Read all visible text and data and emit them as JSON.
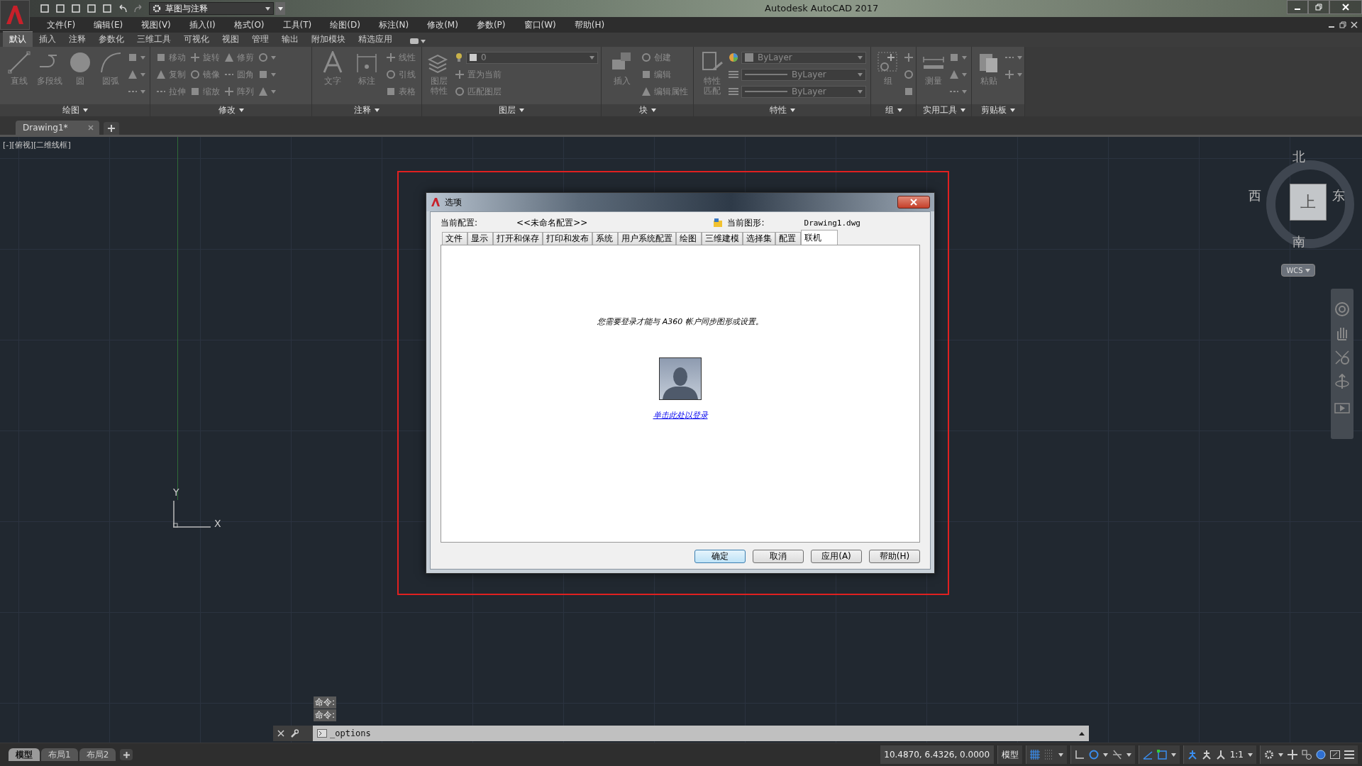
{
  "title_bar": {
    "workspace": "草图与注释",
    "title": "Autodesk AutoCAD 2017"
  },
  "menu": [
    "文件(F)",
    "编辑(E)",
    "视图(V)",
    "插入(I)",
    "格式(O)",
    "工具(T)",
    "绘图(D)",
    "标注(N)",
    "修改(M)",
    "参数(P)",
    "窗口(W)",
    "帮助(H)"
  ],
  "ribbon_tabs": [
    {
      "label": "默认",
      "selected": true
    },
    {
      "label": "插入",
      "selected": false
    },
    {
      "label": "注释",
      "selected": false
    },
    {
      "label": "参数化",
      "selected": false
    },
    {
      "label": "三维工具",
      "selected": false
    },
    {
      "label": "可视化",
      "selected": false
    },
    {
      "label": "视图",
      "selected": false
    },
    {
      "label": "管理",
      "selected": false
    },
    {
      "label": "输出",
      "selected": false
    },
    {
      "label": "附加模块",
      "selected": false
    },
    {
      "label": "精选应用",
      "selected": false
    }
  ],
  "ribbon_panels": [
    {
      "title": "绘图",
      "tools": [
        {
          "kind": "large",
          "label": "直线"
        },
        {
          "kind": "large",
          "label": "多段线"
        },
        {
          "kind": "large",
          "label": "圆"
        },
        {
          "kind": "large",
          "label": "圆弧"
        },
        {
          "kind": "stack",
          "rows": [
            {
              "kind": "icon"
            },
            {
              "kind": "icon"
            },
            {
              "kind": "icon"
            }
          ]
        }
      ]
    },
    {
      "title": "修改",
      "tools": [
        {
          "kind": "stack",
          "rows": [
            {
              "kind": "tool",
              "label": "移动"
            },
            {
              "kind": "tool",
              "label": "复制"
            },
            {
              "kind": "tool",
              "label": "拉伸"
            }
          ]
        },
        {
          "kind": "stack",
          "rows": [
            {
              "kind": "tool",
              "label": "旋转"
            },
            {
              "kind": "tool",
              "label": "镜像"
            },
            {
              "kind": "tool",
              "label": "缩放"
            }
          ]
        },
        {
          "kind": "stack",
          "rows": [
            {
              "kind": "tool",
              "label": "修剪"
            },
            {
              "kind": "tool",
              "label": "圆角"
            },
            {
              "kind": "tool",
              "label": "阵列"
            }
          ]
        },
        {
          "kind": "stack",
          "rows": [
            {
              "kind": "icon"
            },
            {
              "kind": "icon"
            },
            {
              "kind": "icon"
            }
          ]
        }
      ]
    },
    {
      "title": "注释",
      "tools": [
        {
          "kind": "large",
          "label": "文字"
        },
        {
          "kind": "large",
          "label": "标注"
        },
        {
          "kind": "stack",
          "rows": [
            {
              "kind": "tool",
              "label": "线性"
            },
            {
              "kind": "tool",
              "label": "引线"
            },
            {
              "kind": "tool",
              "label": "表格"
            }
          ]
        }
      ]
    },
    {
      "title": "图层",
      "tools": [
        {
          "kind": "large",
          "label": "图层特性"
        },
        {
          "kind": "stack",
          "rows": [
            {
              "kind": "dropdown",
              "value": "0"
            },
            {
              "kind": "tool",
              "label": "置为当前"
            },
            {
              "kind": "tool",
              "label": "匹配图层"
            }
          ]
        }
      ]
    },
    {
      "title": "块",
      "tools": [
        {
          "kind": "large",
          "label": "插入"
        },
        {
          "kind": "stack",
          "rows": [
            {
              "kind": "tool",
              "label": "创建"
            },
            {
              "kind": "tool",
              "label": "编辑"
            },
            {
              "kind": "tool",
              "label": "编辑属性"
            }
          ]
        }
      ]
    },
    {
      "title": "特性",
      "tools": [
        {
          "kind": "large",
          "label": "特性匹配"
        },
        {
          "kind": "stack",
          "rows": [
            {
              "kind": "swatch-dropdown",
              "value": "ByLayer"
            },
            {
              "kind": "line-dropdown",
              "value": "ByLayer"
            },
            {
              "kind": "line-dropdown",
              "value": "ByLayer"
            }
          ]
        }
      ]
    },
    {
      "title": "组",
      "tools": [
        {
          "kind": "large",
          "label": "组"
        },
        {
          "kind": "stack",
          "rows": [
            {
              "kind": "icon"
            },
            {
              "kind": "icon"
            },
            {
              "kind": "icon"
            }
          ]
        }
      ]
    },
    {
      "title": "实用工具",
      "tools": [
        {
          "kind": "large",
          "label": "测量"
        },
        {
          "kind": "stack",
          "rows": [
            {
              "kind": "icon"
            },
            {
              "kind": "icon"
            },
            {
              "kind": "icon"
            }
          ]
        }
      ]
    },
    {
      "title": "剪贴板",
      "tools": [
        {
          "kind": "large",
          "label": "粘贴"
        },
        {
          "kind": "stack",
          "rows": [
            {
              "kind": "icon"
            },
            {
              "kind": "icon"
            }
          ]
        }
      ]
    }
  ],
  "file_tabs": [
    {
      "label": "Drawing1*",
      "selected": true
    }
  ],
  "viewport_label": "[-][俯视][二维线框]",
  "ucs": {
    "y": "Y",
    "x": "X"
  },
  "viewcube": {
    "north": "北",
    "west": "西",
    "east": "东",
    "south": "南",
    "top": "上",
    "wcs": "WCS"
  },
  "dialog": {
    "title": "选项",
    "config_label": "当前配置:",
    "config_value": "<<未命名配置>>",
    "drawing_label": "当前图形:",
    "drawing_value": "Drawing1.dwg",
    "tabs": [
      {
        "label": "文件",
        "selected": false
      },
      {
        "label": "显示",
        "selected": false
      },
      {
        "label": "打开和保存",
        "selected": false
      },
      {
        "label": "打印和发布",
        "selected": false
      },
      {
        "label": "系统",
        "selected": false
      },
      {
        "label": "用户系统配置",
        "selected": false
      },
      {
        "label": "绘图",
        "selected": false
      },
      {
        "label": "三维建模",
        "selected": false
      },
      {
        "label": "选择集",
        "selected": false
      },
      {
        "label": "配置",
        "selected": false
      },
      {
        "label": "联机",
        "selected": true
      }
    ],
    "message": "您需要登录才能与 A360 帐户同步图形或设置。",
    "link": "单击此处以登录",
    "buttons": [
      {
        "label": "确定",
        "default": true
      },
      {
        "label": "取消",
        "default": false
      },
      {
        "label": "应用(A)",
        "default": false
      },
      {
        "label": "帮助(H)",
        "default": false
      }
    ]
  },
  "command": {
    "history": [
      "命令:",
      "命令:"
    ],
    "input": "_options"
  },
  "status_bar": {
    "layout_tabs": [
      {
        "label": "模型",
        "selected": true
      },
      {
        "label": "布局1",
        "selected": false
      },
      {
        "label": "布局2",
        "selected": false
      }
    ],
    "coordinates": "10.4870, 6.4326, 0.0000",
    "mode": "模型",
    "scale": "1:1"
  }
}
